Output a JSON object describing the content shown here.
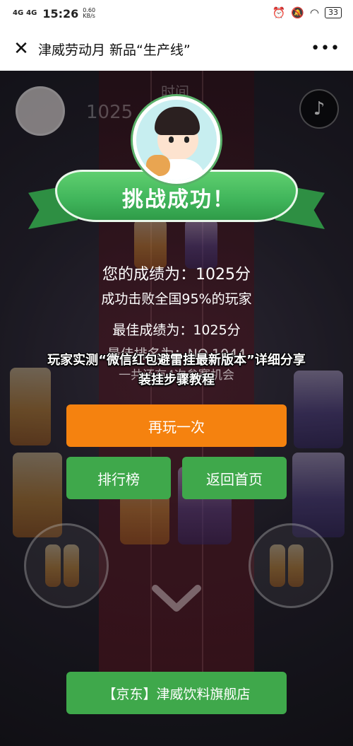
{
  "status_bar": {
    "signal1": "4G",
    "signal2": "4G",
    "time": "15:26",
    "speed_value": "0.60",
    "speed_unit": "KB/s",
    "battery": "33"
  },
  "title_bar": {
    "title": "津威劳动月 新品“生产线”",
    "close_icon": "close-icon",
    "more_icon": "more-icon"
  },
  "background": {
    "time_label": "时间",
    "score": "1025"
  },
  "result": {
    "banner": "挑战成功！",
    "score_text": "您的成绩为：1025分",
    "beat_text": "成功击败全国95%的玩家",
    "best_score_text": "最佳成绩为：1025分",
    "best_rank_text": "最佳排名为：NO.1044",
    "hint_text": "一共还有4次参赛机会"
  },
  "caption": "玩家实测“微信红包避雷挂最新版本”详细分享装挂步骤教程",
  "buttons": {
    "replay": "再玩一次",
    "leaderboard": "排行榜",
    "home": "返回首页",
    "shop": "【京东】津威饮料旗舰店"
  },
  "colors": {
    "accent_orange": "#f5820f",
    "accent_green": "#3fa84b",
    "ribbon_green": "#3fb45a"
  }
}
